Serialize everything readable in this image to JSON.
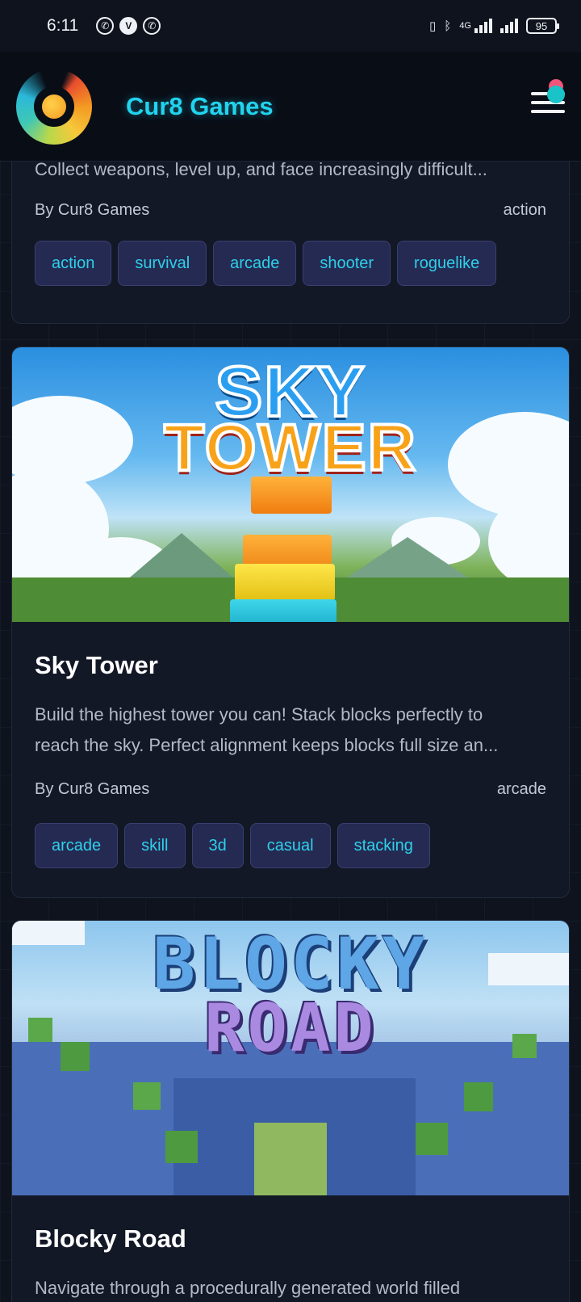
{
  "status_bar": {
    "time": "6:11",
    "network": "4G",
    "battery": "95"
  },
  "header": {
    "app_title": "Cur8 Games"
  },
  "cards": [
    {
      "title": "",
      "description_lines": [
        "Collect weapons, level up, and face increasingly difficult..."
      ],
      "author": "By Cur8 Games",
      "category": "action",
      "tags": [
        "action",
        "survival",
        "arcade",
        "shooter",
        "roguelike"
      ]
    },
    {
      "title": "Sky Tower",
      "image_text": [
        "SKY",
        "TOWER"
      ],
      "description_lines": [
        "Build the highest tower you can! Stack blocks perfectly to",
        "reach the sky. Perfect alignment keeps blocks full size an..."
      ],
      "author": "By Cur8 Games",
      "category": "arcade",
      "tags": [
        "arcade",
        "skill",
        "3d",
        "casual",
        "stacking"
      ]
    },
    {
      "title": "Blocky Road",
      "image_text": [
        "BLOCKY",
        "ROAD"
      ],
      "description_lines": [
        "Navigate through a procedurally generated world filled"
      ]
    }
  ],
  "colors": {
    "accent": "#22d3ee",
    "background": "#0f131d",
    "card": "#131827",
    "tag_bg": "#252a52"
  }
}
